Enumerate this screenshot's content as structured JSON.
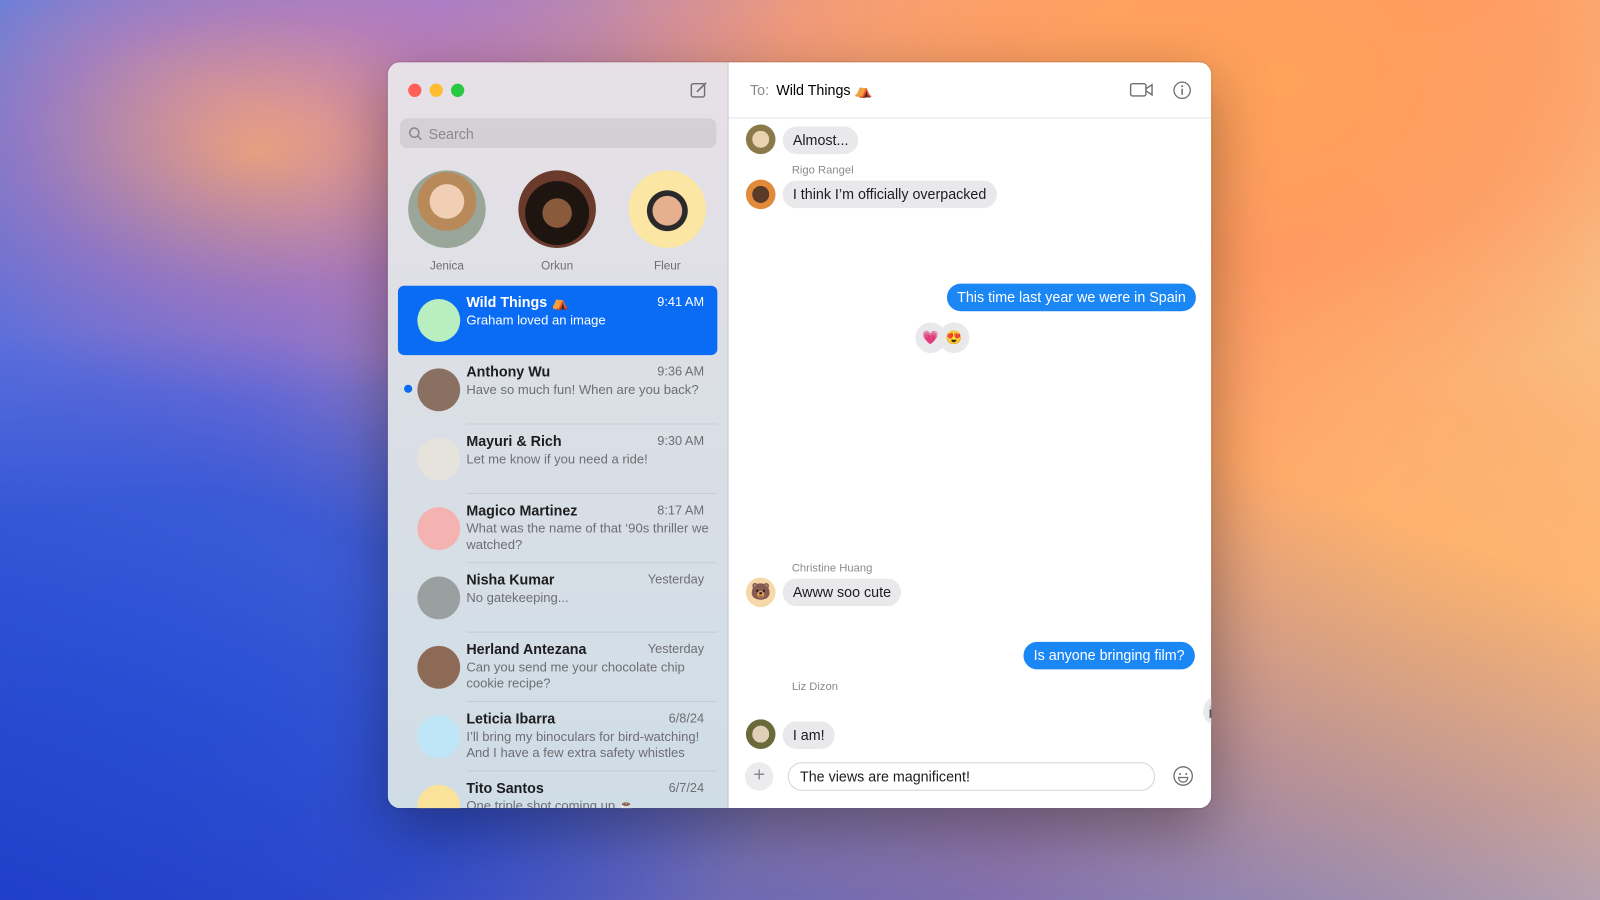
{
  "sidebar": {
    "search_placeholder": "Search",
    "pinned": [
      {
        "name": "Jenica",
        "color": "#b8a590"
      },
      {
        "name": "Orkun",
        "color": "#6a3a2c"
      },
      {
        "name": "Fleur",
        "color": "#fbe6a3"
      }
    ],
    "conversations": [
      {
        "name": "Wild Things ⛺",
        "time": "9:41 AM",
        "preview": "Graham loved an image",
        "selected": true,
        "color": "#b9eec0"
      },
      {
        "name": "Anthony Wu",
        "time": "9:36 AM",
        "preview": "Have so much fun! When are you back?",
        "unread": true,
        "color": "#8a7060"
      },
      {
        "name": "Mayuri & Rich",
        "time": "9:30 AM",
        "preview": "Let me know if you need a ride!",
        "color": "#e6e2dc"
      },
      {
        "name": "Magico Martinez",
        "time": "8:17 AM",
        "preview": "What was the name of that ‘90s thriller we watched?",
        "color": "#f4b2b0"
      },
      {
        "name": "Nisha Kumar",
        "time": "Yesterday",
        "preview": "No gatekeeping...",
        "color": "#9aa0a0"
      },
      {
        "name": "Herland Antezana",
        "time": "Yesterday",
        "preview": "Can you send me your chocolate chip cookie recipe?",
        "color": "#8d6a55"
      },
      {
        "name": "Leticia Ibarra",
        "time": "6/8/24",
        "preview": "I’ll bring my binoculars for bird-watching! And I have a few extra safety whistles",
        "color": "#bfe6f6"
      },
      {
        "name": "Tito Santos",
        "time": "6/7/24",
        "preview": "One triple shot coming up ☕",
        "color": "#fbe29a"
      }
    ]
  },
  "header": {
    "to_label": "To:",
    "recipient": "Wild Things ⛺"
  },
  "messages": {
    "m1": "Almost...",
    "rigo_name": "Rigo Rangel",
    "m2": "I think I’m officially overpacked",
    "m3": "This time last year we were in Spain",
    "reactions_photo": [
      "💗",
      "😍"
    ],
    "christine_name": "Christine Huang",
    "m4": "Awww soo cute",
    "christine_avatar": "🐻",
    "thumbs": "👍",
    "m5": "Is anyone bringing film?",
    "liz_name": "Liz Dizon",
    "camera": "📸",
    "m6": "I am!",
    "memoji": "😂"
  },
  "composer": {
    "value": "The views are magnificent!"
  },
  "colors": {
    "accent": "#0a6cf5",
    "outgoing_bubble": "#1b87f5",
    "incoming_bubble": "#e9e9eb"
  }
}
